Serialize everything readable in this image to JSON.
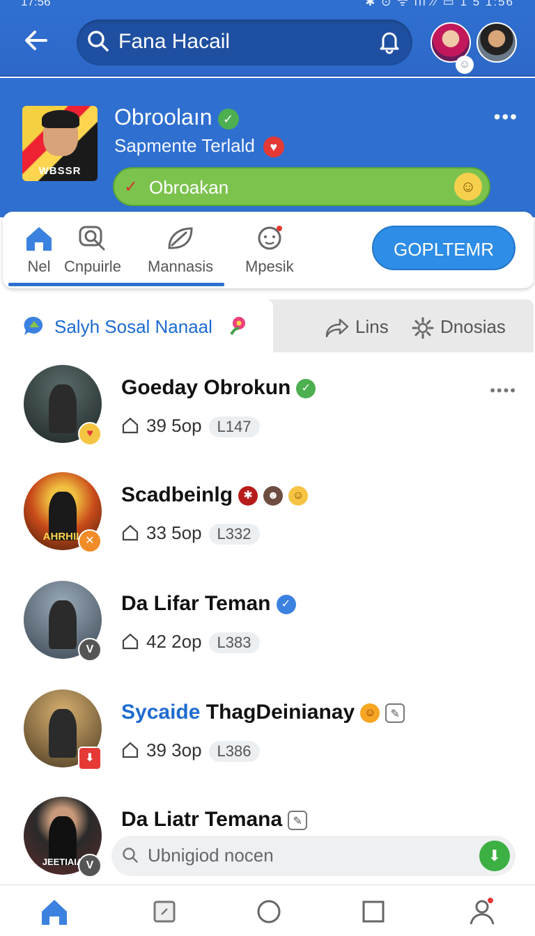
{
  "status_bar": {
    "time": "17:56",
    "right_text": "✱ ⊙ ᯤ ıll ⁄⁄ ▭ 1 5 1:56"
  },
  "top_bar": {
    "search_text": "Fana Hacail"
  },
  "page": {
    "title": "Obroolaın",
    "subtitle": "Sapmente Terlald",
    "thumb_caption": "WBSSR",
    "status_label": "Obroakan"
  },
  "nav": {
    "items": [
      {
        "label": "Nel",
        "icon": "home-icon"
      },
      {
        "label": "Cnpuirle",
        "icon": "search-chat-icon"
      },
      {
        "label": "Mannasis",
        "icon": "leaf-icon"
      },
      {
        "label": "Mpesik",
        "icon": "face-icon"
      }
    ],
    "complete_button": "GOPLTEMR"
  },
  "sub_tabs": {
    "active": "Salyh Sosal Nanaal",
    "others": [
      "Lins",
      "Dnosias"
    ]
  },
  "posts": [
    {
      "name": "Goeday Obrokun",
      "count": "39",
      "unit": "5op",
      "tag": "L147",
      "badge_color": "#f4c542",
      "badge_text": "♥",
      "avatar_bg": "#2e3a3a"
    },
    {
      "name": "Scadbeinlg",
      "count": "33",
      "unit": "5op",
      "tag": "L332",
      "badge_color": "#f28c28",
      "badge_text": "✕",
      "avatar_bg": "#d24b1a",
      "caption": "AHRHIL"
    },
    {
      "name": "Da Lifar Teman",
      "count": "42",
      "unit": "2op",
      "tag": "L383",
      "badge_color": "#555555",
      "badge_text": "V",
      "avatar_bg": "#5b6b78"
    },
    {
      "name_highlight": "Sycaide",
      "name_rest": "ThagDeinianay",
      "count": "39",
      "unit": "3op",
      "tag": "L386",
      "badge_color": "#e53935",
      "badge_text": "⬇",
      "avatar_bg": "#6b5a3a"
    },
    {
      "name": "Da Liatr Temana",
      "badge_color": "#555555",
      "badge_text": "V",
      "avatar_bg": "#3a2a2a",
      "caption": "JEETIAIA"
    }
  ],
  "comment_bar": {
    "placeholder": "Ubnigiod nocen"
  },
  "colors": {
    "primary": "#2f6fd0",
    "green": "#7cc34e",
    "button": "#2e8de6"
  }
}
